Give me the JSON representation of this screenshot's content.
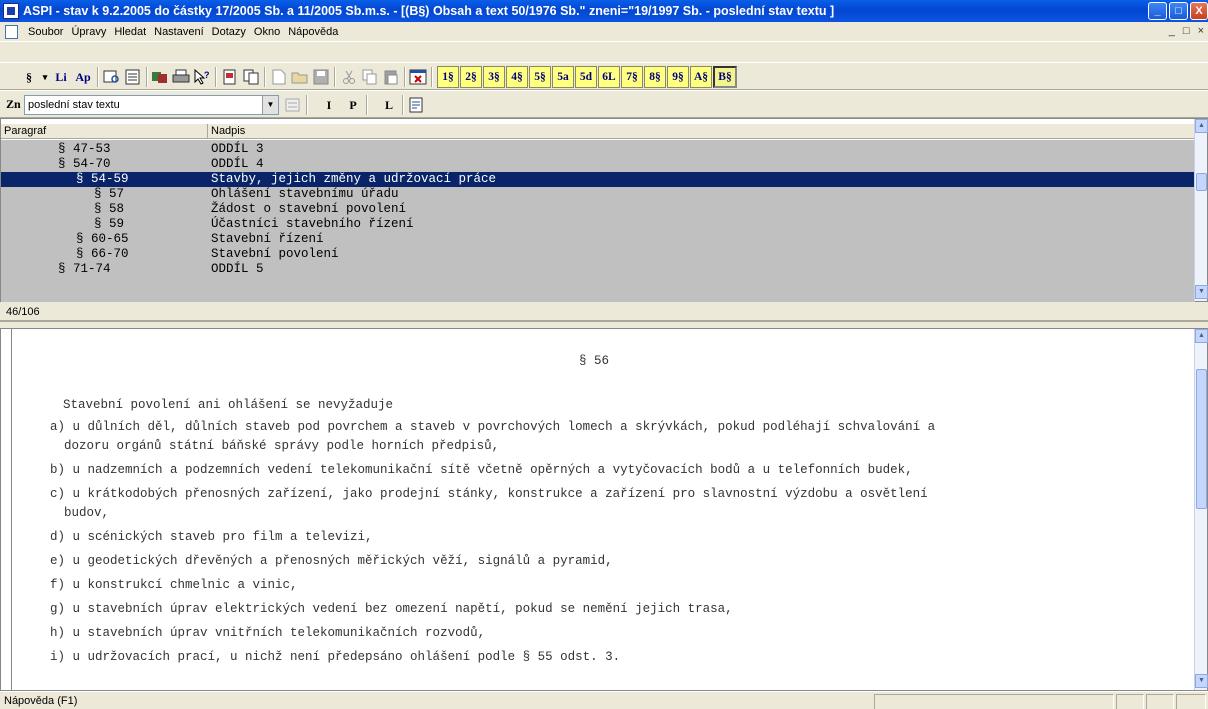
{
  "window": {
    "title": "ASPI  - stav k 9.2.2005 do částky 17/2005 Sb. a 11/2005 Sb.m.s. - [(B§)  Obsah a text 50/1976 Sb.\" zneni=\"19/1997 Sb. - poslední stav textu ]",
    "buttons": {
      "minimize": "_",
      "maximize": "□",
      "close": "X"
    }
  },
  "menubar": {
    "items": [
      "Soubor",
      "Úpravy",
      "Hledat",
      "Nastavení",
      "Dotazy",
      "Okno",
      "Nápověda"
    ],
    "mdi_controls": [
      "_",
      "□",
      "×"
    ]
  },
  "toolbar1": {
    "text_buttons": [
      "§",
      "▾",
      "Li",
      "Ap"
    ],
    "yellow_buttons": [
      "1§",
      "2§",
      "3§",
      "4§",
      "5§",
      "5a",
      "5d",
      "6L",
      "7§",
      "8§",
      "9§",
      "A§",
      "B§"
    ],
    "active_button": "B§"
  },
  "toolbar2": {
    "zn_label": "Zn",
    "zn_select_value": "poslední stav textu",
    "format_buttons": [
      "I",
      "P",
      "L"
    ]
  },
  "upper_panel": {
    "columns": [
      "Paragraf",
      "Nadpis"
    ],
    "rows": [
      {
        "paragraf": "§ 47-53",
        "nadpis": "ODDÍL 3"
      },
      {
        "paragraf": "§ 54-70",
        "nadpis": "ODDÍL 4"
      },
      {
        "paragraf": "§ 54-59",
        "nadpis": "Stavby, jejich změny a udržovací práce"
      },
      {
        "paragraf": "§ 57",
        "nadpis": "Ohlášení stavebnímu úřadu"
      },
      {
        "paragraf": "§ 58",
        "nadpis": "Žádost o stavební povolení"
      },
      {
        "paragraf": "§ 59",
        "nadpis": "Účastníci stavebního řízení"
      },
      {
        "paragraf": "§ 60-65",
        "nadpis": "Stavební řízení"
      },
      {
        "paragraf": "§ 66-70",
        "nadpis": "Stavební povolení"
      },
      {
        "paragraf": "§ 71-74",
        "nadpis": "ODDÍL 5"
      }
    ],
    "selected_row": 2,
    "counter": "46/106"
  },
  "document": {
    "heading": "§ 56",
    "intro": "Stavební povolení ani ohlášení se nevyžaduje",
    "lines": [
      "a) u důlních děl, důlních staveb pod povrchem a staveb v povrchových lomech a skrývkách, pokud podléhají schvalování a",
      "dozoru orgánů státní báňské správy podle horních předpisů,",
      "b) u nadzemních a podzemních vedení telekomunikační sítě včetně opěrných a vytyčovacích bodů a u telefonních budek,",
      "c) u krátkodobých přenosných zařízení, jako prodejní stánky, konstrukce a zařízení pro slavnostní výzdobu a osvětlení",
      "budov,",
      "d) u scénických staveb pro film a televizi,",
      "e) u geodetických dřevěných a přenosných měřických věží, signálů a pyramid,",
      "f) u konstrukcí chmelnic a vinic,",
      "g) u stavebních úprav elektrických vedení bez omezení napětí, pokud se nemění jejich trasa,",
      "h) u stavebních úprav vnitřních telekomunikačních rozvodů,",
      "i) u udržovacích prací, u nichž není předepsáno ohlášení podle § 55 odst. 3."
    ]
  },
  "statusbar": {
    "text": "Nápověda (F1)"
  }
}
